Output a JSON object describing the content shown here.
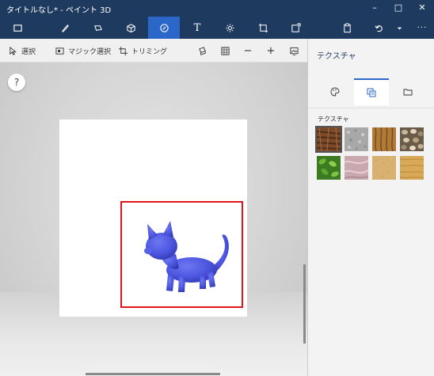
{
  "window": {
    "title": "タイトルなし* - ペイント 3D",
    "controls": {
      "minimize": "–",
      "maximize": "□",
      "close": "✕"
    }
  },
  "toolbar": {
    "tools": [
      {
        "name": "menu-icon"
      },
      {
        "name": "brush-icon"
      },
      {
        "name": "2d-shapes-icon"
      },
      {
        "name": "3d-shapes-icon"
      },
      {
        "name": "stickers-icon",
        "active": true
      },
      {
        "name": "text-icon",
        "glyph": "T"
      },
      {
        "name": "effects-icon"
      },
      {
        "name": "canvas-icon"
      },
      {
        "name": "remix3d-icon"
      }
    ],
    "right_tools": [
      {
        "name": "paste-icon"
      },
      {
        "name": "undo-icon"
      },
      {
        "name": "dropdown-icon"
      },
      {
        "name": "more-icon",
        "glyph": "···"
      }
    ]
  },
  "commands": {
    "select_label": "選択",
    "magic_select_label": "マジック選択",
    "crop_label": "トリミング",
    "zoom_out": "−",
    "zoom_in": "+"
  },
  "workspace": {
    "help_label": "?"
  },
  "panel": {
    "title": "テクスチャ",
    "section_label": "テクスチャ",
    "tabs": [
      {
        "name": "colors-tab-icon"
      },
      {
        "name": "textures-tab-icon",
        "active": true
      },
      {
        "name": "folder-tab-icon"
      }
    ],
    "textures": [
      {
        "name": "bark-texture",
        "color": "#7a4a2a"
      },
      {
        "name": "gravel-texture",
        "color": "#a8a8a8"
      },
      {
        "name": "wood-grain-texture",
        "color": "#b07a38"
      },
      {
        "name": "pebbles-texture",
        "color": "#8a7a62"
      },
      {
        "name": "leaves-texture",
        "color": "#4a8a2a"
      },
      {
        "name": "marble-pink-texture",
        "color": "#c9a8b0"
      },
      {
        "name": "sand-texture",
        "color": "#d8b070"
      },
      {
        "name": "light-wood-texture",
        "color": "#d9a95a"
      }
    ]
  },
  "colors": {
    "titlebar": "#1f3a5f",
    "accent": "#2b67c8",
    "selection": "#e0161b",
    "cat": "#4d56e0"
  }
}
